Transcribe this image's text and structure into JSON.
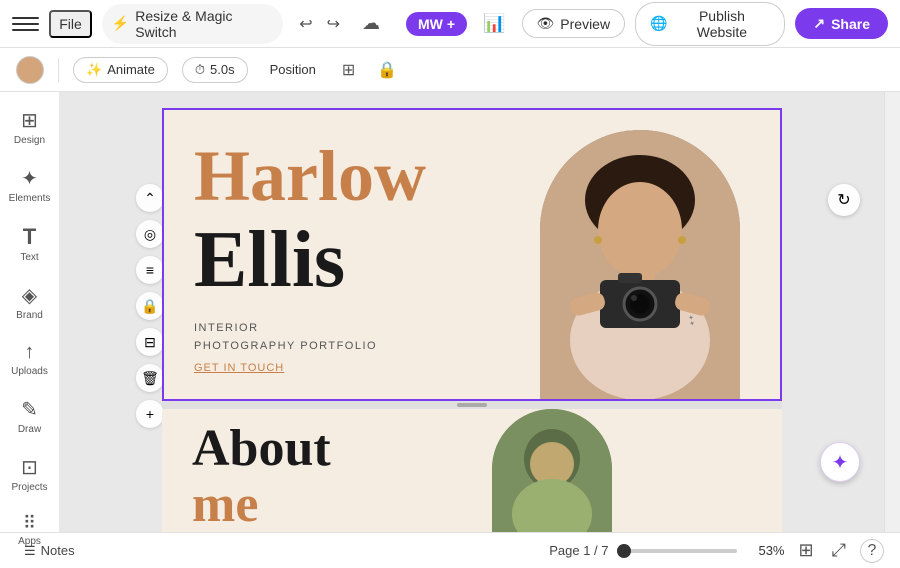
{
  "toolbar": {
    "menu_label": "Menu",
    "file_label": "File",
    "project_name": "Resize & Magic Switch",
    "mw_label": "MW",
    "preview_label": "Preview",
    "publish_label": "Publish Website",
    "share_label": "Share",
    "animate_label": "Animate",
    "duration_label": "5.0s",
    "position_label": "Position"
  },
  "sidebar": {
    "items": [
      {
        "id": "design",
        "label": "Design",
        "icon": "⊞"
      },
      {
        "id": "elements",
        "label": "Elements",
        "icon": "✦"
      },
      {
        "id": "text",
        "label": "Text",
        "icon": "T"
      },
      {
        "id": "brand",
        "label": "Brand",
        "icon": "◈"
      },
      {
        "id": "uploads",
        "label": "Uploads",
        "icon": "↑"
      },
      {
        "id": "draw",
        "label": "Draw",
        "icon": "✎"
      },
      {
        "id": "projects",
        "label": "Projects",
        "icon": "⊡"
      },
      {
        "id": "apps",
        "label": "Apps",
        "icon": "⠿"
      }
    ]
  },
  "slide1": {
    "title_line1": "Harlow",
    "title_line2": "Ellis",
    "subtitle_line1": "INTERIOR",
    "subtitle_line2": "PHOTOGRAPHY PORTFOLIO",
    "cta": "GET IN TOUCH"
  },
  "slide2": {
    "about_line1": "About",
    "about_line2": "me"
  },
  "bottom_bar": {
    "notes_label": "Notes",
    "page_label": "Page 1 / 7",
    "zoom_label": "53%",
    "question_label": "?"
  },
  "colors": {
    "accent_purple": "#7c3aed",
    "text_orange": "#c8804a",
    "bg_cream": "#f5ede2"
  }
}
